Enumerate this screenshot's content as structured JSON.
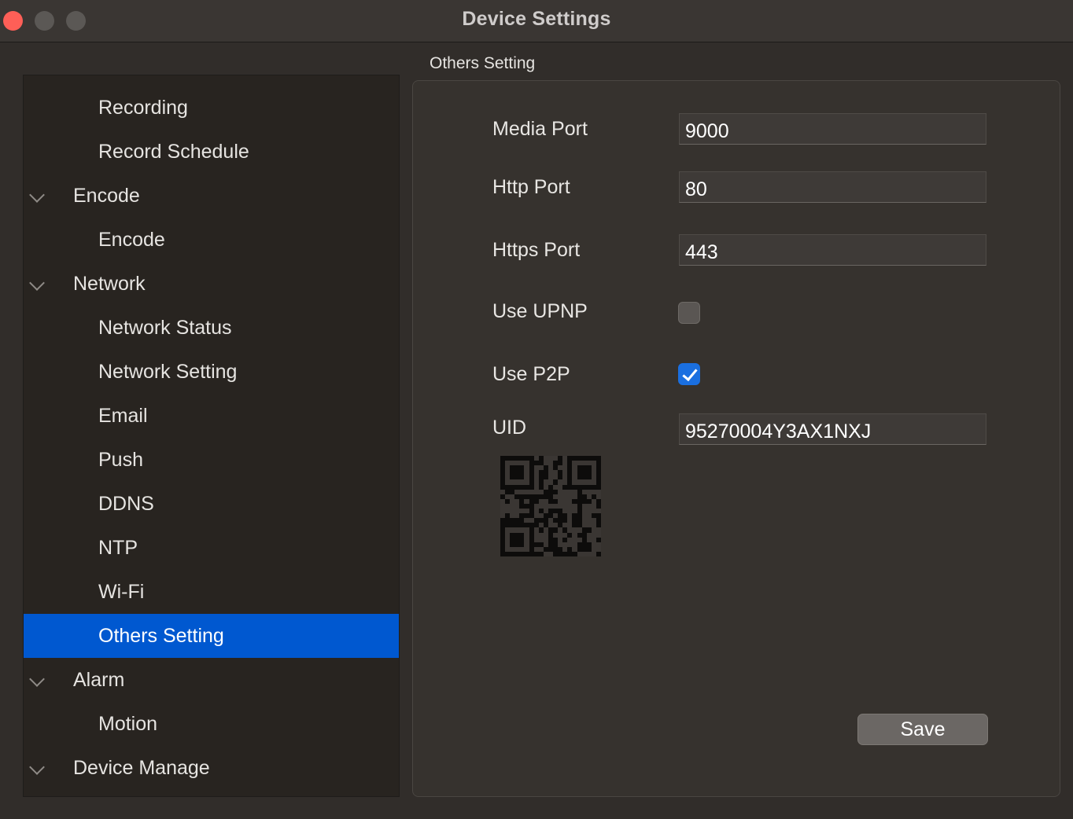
{
  "window": {
    "title": "Device Settings"
  },
  "sidebar": {
    "items": [
      {
        "label": "Recording",
        "kind": "child",
        "selected": false
      },
      {
        "label": "Record Schedule",
        "kind": "child",
        "selected": false
      },
      {
        "label": "Encode",
        "kind": "parent",
        "expanded": true,
        "selected": false
      },
      {
        "label": "Encode",
        "kind": "child",
        "selected": false
      },
      {
        "label": "Network",
        "kind": "parent",
        "expanded": true,
        "selected": false
      },
      {
        "label": "Network Status",
        "kind": "child",
        "selected": false
      },
      {
        "label": "Network Setting",
        "kind": "child",
        "selected": false
      },
      {
        "label": "Email",
        "kind": "child",
        "selected": false
      },
      {
        "label": "Push",
        "kind": "child",
        "selected": false
      },
      {
        "label": "DDNS",
        "kind": "child",
        "selected": false
      },
      {
        "label": "NTP",
        "kind": "child",
        "selected": false
      },
      {
        "label": "Wi-Fi",
        "kind": "child",
        "selected": false
      },
      {
        "label": "Others Setting",
        "kind": "child",
        "selected": true
      },
      {
        "label": "Alarm",
        "kind": "parent",
        "expanded": true,
        "selected": false
      },
      {
        "label": "Motion",
        "kind": "child",
        "selected": false
      },
      {
        "label": "Device Manage",
        "kind": "parent",
        "expanded": true,
        "selected": false
      }
    ],
    "selected_color": "#0058d0",
    "chevron_icon": "chevron-down-icon"
  },
  "main": {
    "group_title": "Others Setting",
    "media_port": {
      "label": "Media Port",
      "value": "9000"
    },
    "http_port": {
      "label": "Http Port",
      "value": "80"
    },
    "https_port": {
      "label": "Https Port",
      "value": "443"
    },
    "use_upnp": {
      "label": "Use UPNP",
      "checked": false
    },
    "use_p2p": {
      "label": "Use P2P",
      "checked": true
    },
    "uid": {
      "label": "UID",
      "value": "95270004Y3AX1NXJ"
    },
    "qr_icon": "qr-code-icon",
    "save_label": "Save"
  },
  "colors": {
    "accent": "#1a6fe0",
    "close_button": "#fe5f57"
  }
}
